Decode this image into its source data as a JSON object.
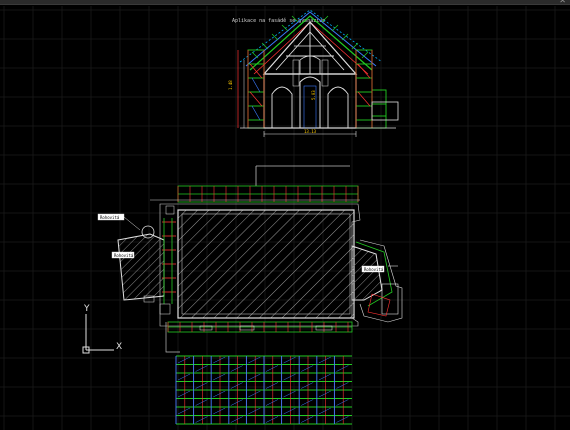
{
  "window": {
    "close_glyph": "✕"
  },
  "drawing": {
    "elevation_title": "Aplikace na fasádě se gymnázium",
    "dim_width": "13.13",
    "dim_height": "1.48",
    "dim_inner": "5.03",
    "plan_tags": [
      "Rohovitá",
      "Rohovitá",
      "Rohovitá"
    ]
  },
  "ucs": {
    "x_label": "X",
    "y_label": "Y",
    "icon": "ucs-icon"
  },
  "colors": {
    "background": "#000000",
    "grid": "#1c1c1c",
    "scaffold": "#22cc22",
    "wall": "#e0e0e0",
    "frame": "#3b7bff",
    "accent": "#ff3333",
    "roof": "#00b0ff"
  }
}
